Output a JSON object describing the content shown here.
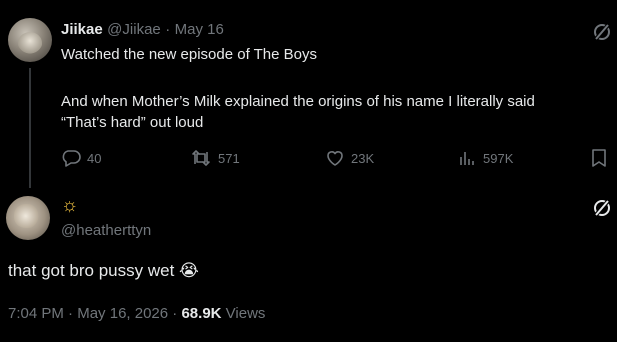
{
  "tweet": {
    "author_name": "Jiikae",
    "author_handle": "@Jiikae",
    "separator": "·",
    "date": "May 16",
    "text_line1": "Watched the new episode of The Boys",
    "text_line2": "And when Mother’s Milk explained the origins of his name I literally said",
    "text_line3": "“That’s hard” out loud",
    "replies": "40",
    "retweets": "571",
    "likes": "23K",
    "views": "597K"
  },
  "reply": {
    "author_name": "☼",
    "author_handle": "@heatherttyn",
    "text": "that got bro pussy wet 😭",
    "time": "7:04 PM",
    "separator": "·",
    "date": "May 16, 2026",
    "separator2": "·",
    "views_count": "68.9K",
    "views_label": "Views"
  },
  "icons": [
    "grok-icon",
    "reply-icon",
    "retweet-icon",
    "like-icon",
    "views-icon",
    "bookmark-icon"
  ]
}
